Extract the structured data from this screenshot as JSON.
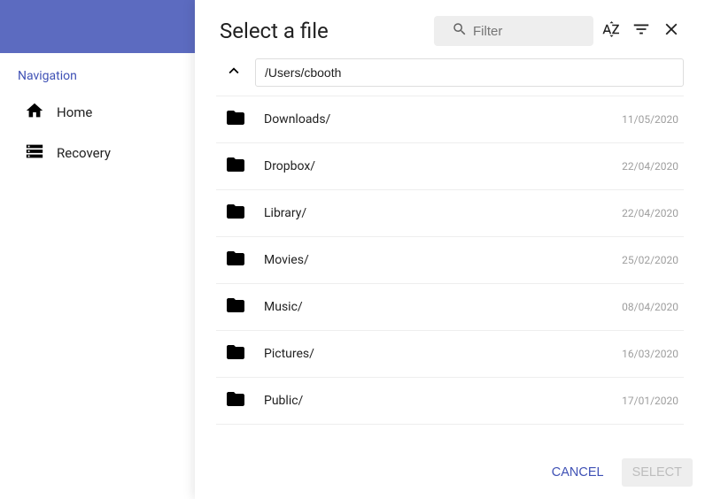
{
  "sidebar": {
    "section_title": "Navigation",
    "items": [
      {
        "icon": "home",
        "label": "Home"
      },
      {
        "icon": "storage",
        "label": "Recovery"
      }
    ]
  },
  "dialog": {
    "title": "Select a file",
    "filter_placeholder": "Filter",
    "path": "/Users/cbooth",
    "files": [
      {
        "name": "Downloads/",
        "date": "11/05/2020"
      },
      {
        "name": "Dropbox/",
        "date": "22/04/2020"
      },
      {
        "name": "Library/",
        "date": "22/04/2020"
      },
      {
        "name": "Movies/",
        "date": "25/02/2020"
      },
      {
        "name": "Music/",
        "date": "08/04/2020"
      },
      {
        "name": "Pictures/",
        "date": "16/03/2020"
      },
      {
        "name": "Public/",
        "date": "17/01/2020"
      }
    ],
    "cancel_label": "CANCEL",
    "select_label": "SELECT"
  }
}
